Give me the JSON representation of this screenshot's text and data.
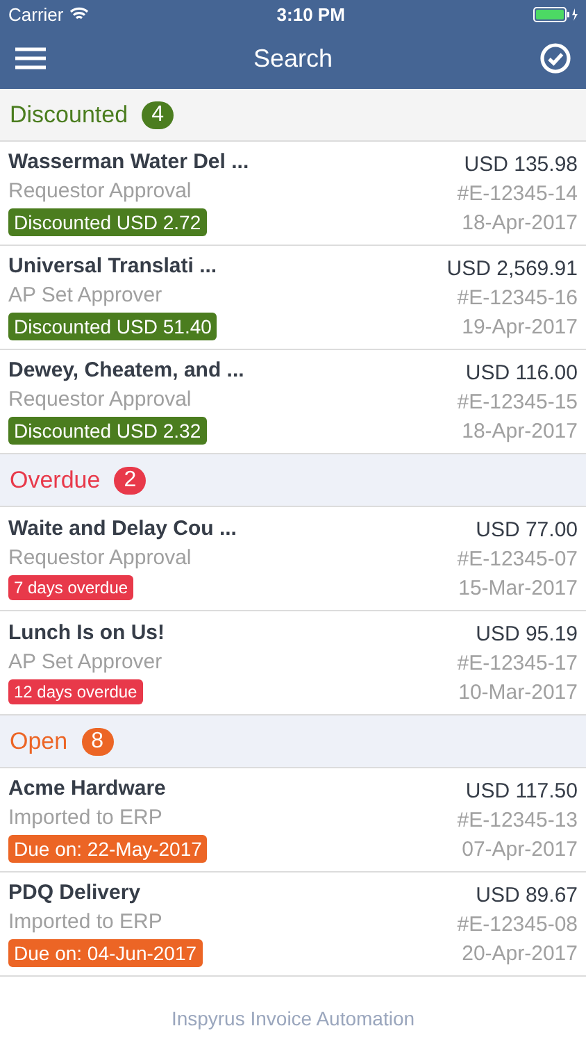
{
  "status_bar": {
    "carrier": "Carrier",
    "time": "3:10 PM"
  },
  "nav": {
    "title": "Search"
  },
  "sections": [
    {
      "kind": "discounted",
      "title": "Discounted",
      "count": "4",
      "color": "#4b7d1f",
      "items": [
        {
          "name": "Wasserman Water Del ...",
          "step": "Requestor Approval",
          "tag": "Discounted USD 2.72",
          "amount": "USD 135.98",
          "number": "#E-12345-14",
          "date": "18-Apr-2017"
        },
        {
          "name": "Universal Translati ...",
          "step": "AP Set Approver",
          "tag": "Discounted USD 51.40",
          "amount": "USD 2,569.91",
          "number": "#E-12345-16",
          "date": "19-Apr-2017"
        },
        {
          "name": "Dewey, Cheatem, and ...",
          "step": "Requestor Approval",
          "tag": "Discounted USD 2.32",
          "amount": "USD 116.00",
          "number": "#E-12345-15",
          "date": "18-Apr-2017"
        }
      ]
    },
    {
      "kind": "overdue",
      "title": "Overdue",
      "count": "2",
      "color": "#e8394a",
      "items": [
        {
          "name": "Waite and Delay Cou ...",
          "step": "Requestor Approval",
          "tag": "7 days overdue",
          "amount": "USD 77.00",
          "number": "#E-12345-07",
          "date": "15-Mar-2017"
        },
        {
          "name": "Lunch Is on Us!",
          "step": "AP Set Approver",
          "tag": "12 days overdue",
          "amount": "USD 95.19",
          "number": "#E-12345-17",
          "date": "10-Mar-2017"
        }
      ]
    },
    {
      "kind": "open",
      "title": "Open",
      "count": "8",
      "color": "#ec6525",
      "items": [
        {
          "name": "Acme Hardware",
          "step": "Imported to ERP",
          "tag": "Due on: 22-May-2017",
          "amount": "USD 117.50",
          "number": "#E-12345-13",
          "date": "07-Apr-2017"
        },
        {
          "name": "PDQ Delivery",
          "step": "Imported to ERP",
          "tag": "Due on: 04-Jun-2017",
          "amount": "USD 89.67",
          "number": "#E-12345-08",
          "date": "20-Apr-2017"
        }
      ]
    }
  ],
  "footer": "Inspyrus Invoice Automation"
}
